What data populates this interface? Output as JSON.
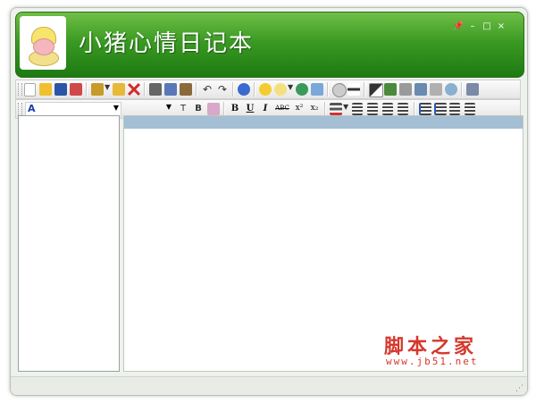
{
  "app": {
    "title": "小猪心情日记本"
  },
  "window_controls": {
    "pin": "📌",
    "minimize": "–",
    "maximize": "□",
    "close": "×"
  },
  "format_toolbar": {
    "font_preview": "A",
    "bold": "B",
    "underline": "U",
    "italic": "I",
    "strike": "ABC",
    "superscript": "x²",
    "subscript": "x₂"
  },
  "watermark": {
    "main": "脚本之家",
    "url": "www.jb51.net"
  },
  "colors": {
    "header_green": "#3b9a23",
    "editor_bar": "#a4bed4",
    "watermark_red": "#d6372c"
  }
}
